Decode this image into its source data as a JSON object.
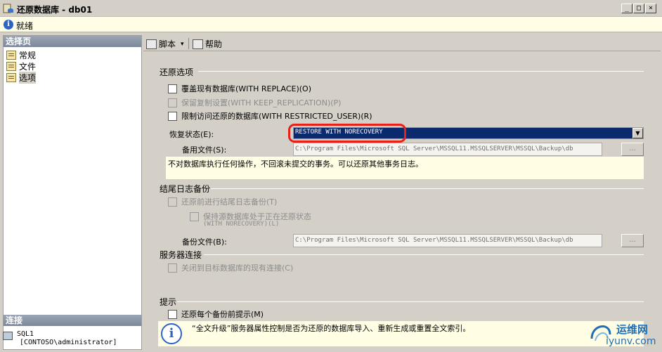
{
  "window": {
    "title": "还原数据库 - db01",
    "min_glyph": "_",
    "max_glyph": "□",
    "close_glyph": "×",
    "status": "就绪"
  },
  "left_pane": {
    "header": "选择页",
    "items": [
      {
        "label": "常规",
        "icon": "page-icon"
      },
      {
        "label": "文件",
        "icon": "page-icon"
      },
      {
        "label": "选项",
        "icon": "page-icon",
        "selected": true
      }
    ],
    "connection": {
      "header": "连接",
      "server": "SQL1",
      "user": "[CONTOSO\\administrator]"
    }
  },
  "toolbar": {
    "script_label": "脚本",
    "dropdown_glyph": "▾",
    "help_label": "帮助"
  },
  "restore_options": {
    "title": "还原选项",
    "overwrite": "覆盖现有数据库(WITH REPLACE)(O)",
    "keep_replication": "保留复制设置(WITH KEEP_REPLICATION)(P)",
    "restricted_user": "限制访问还原的数据库(WITH RESTRICTED_USER)(R)",
    "recovery_state_label": "恢复状态(E):",
    "recovery_state_value": "RESTORE WITH NORECOVERY",
    "combo_glyph": "▼",
    "standby_label": "备用文件(S):",
    "standby_value": "C:\\Program Files\\Microsoft SQL Server\\MSSQL11.MSSQLSERVER\\MSSQL\\Backup\\db",
    "browse_label": "...",
    "description": "不对数据库执行任何操作，不回滚未提交的事务。可以还原其他事务日志。"
  },
  "tail_log": {
    "title": "结尾日志备份",
    "take_tail_log": "还原前进行结尾日志备份(T)",
    "leave_restoring": "保持源数据库处于正在还原状态",
    "leave_restoring_sub": "(WITH NORECOVERY)(L)",
    "backup_file_label": "备份文件(B):",
    "backup_file_value": "C:\\Program Files\\Microsoft SQL Server\\MSSQL11.MSSQLSERVER\\MSSQL\\Backup\\db",
    "browse_label": "..."
  },
  "server_connections": {
    "title": "服务器连接",
    "close_existing": "关闭到目标数据库的现有连接(C)"
  },
  "prompt": {
    "title": "提示",
    "prompt_each": "还原每个备份前提示(M)",
    "info_text": "“全文升级”服务器属性控制是否为还原的数据库导入、重新生成或重置全文索引。"
  },
  "watermark": {
    "cn": "运维网",
    "en": "iyunv.com"
  },
  "colors": {
    "dialog_bg": "#d4d0c8",
    "selection_bg": "#0b2a6e",
    "note_bg": "#fffde4",
    "highlight": "#e8201a",
    "watermark": "#1f6fb5"
  }
}
